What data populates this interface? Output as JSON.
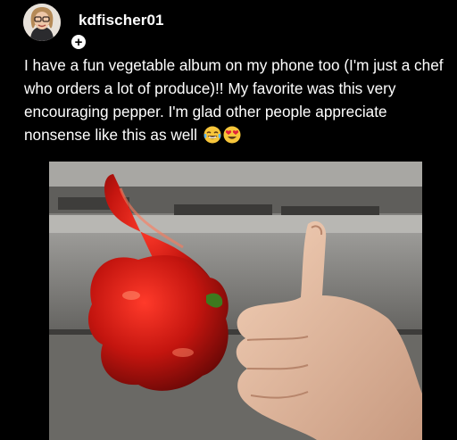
{
  "post": {
    "username": "kdfischer01",
    "caption": "I have a fun vegetable album on my phone too (I'm just a chef who orders a lot of produce)!! My favorite was this very encouraging pepper. I'm glad other people appreciate nonsense like this as well",
    "caption_emojis": [
      "laughing-tears-emoji",
      "heart-eyes-emoji"
    ],
    "follow_icon": "+"
  },
  "colors": {
    "background": "#000000",
    "text": "#ffffff",
    "pepper": "#c4150f"
  }
}
